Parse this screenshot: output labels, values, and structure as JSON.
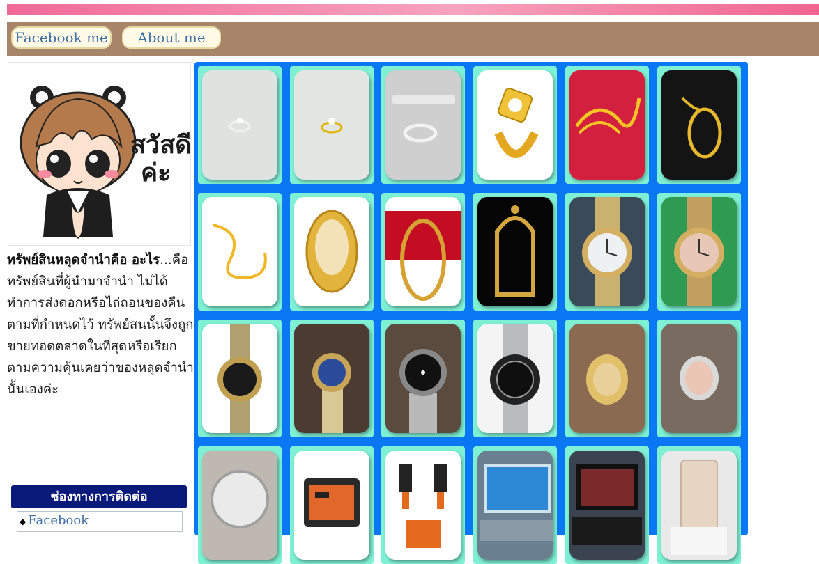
{
  "nav": {
    "facebook_label": "Facebook me",
    "about_label": "About me"
  },
  "sidebar": {
    "mascot_text_line1": "สวัสดี",
    "mascot_text_line2": "ค่ะ",
    "info_heading": "ทรัพย์สินหลุดจำนำคือ อะไร",
    "info_body": "...คือ ทรัพย์สินที่ผู้นำมาจำนำ ไม่ได้ทำการส่งดอกหรือไถ่ถอนของคืนตามที่กำหนดไว้ ทรัพย์สนนั้นจึงถูกขายทอดตลาดในที่สุดหรือเรียกตามความคุ้นเคยว่าของหลุดจำนำนั้นเองค่ะ",
    "contact_header": "ช่องทางการติดต่อ",
    "contact_link": "Facebook"
  },
  "gallery": {
    "items": [
      {
        "name": "silver-diamond-ring-photo"
      },
      {
        "name": "gold-diamond-ring-photo"
      },
      {
        "name": "silver-band-ring-photo"
      },
      {
        "name": "gold-mens-diamond-ring-photo"
      },
      {
        "name": "gold-chain-red-background-photo"
      },
      {
        "name": "gold-necklace-black-background-photo"
      },
      {
        "name": "gold-chain-white-background-photo"
      },
      {
        "name": "gold-amulet-case-photo"
      },
      {
        "name": "gold-amulet-frame-red-photo"
      },
      {
        "name": "gold-amulet-frame-black-photo"
      },
      {
        "name": "rolex-datejust-white-dial-photo"
      },
      {
        "name": "rolex-datejust-rose-dial-photo"
      },
      {
        "name": "rolex-gmt-two-tone-photo"
      },
      {
        "name": "rolex-lady-datejust-blue-dial-photo"
      },
      {
        "name": "rolex-submariner-on-wrist-photo"
      },
      {
        "name": "rolex-submariner-black-photo"
      },
      {
        "name": "rolex-day-date-gold-photo"
      },
      {
        "name": "rolex-datejust-pink-dial-photo"
      },
      {
        "name": "rolex-silver-dial-photo"
      },
      {
        "name": "tool-kit-case-photo"
      },
      {
        "name": "cordless-drill-set-photo"
      },
      {
        "name": "laptop-windows-photo"
      },
      {
        "name": "gaming-laptop-photo"
      },
      {
        "name": "iphone-gold-photo"
      }
    ]
  },
  "colors": {
    "gallery_background": "#0a78f4",
    "tile_frame": "#7ef0d4",
    "nav_background": "#a88468",
    "contact_header_background": "#0a1a7a"
  }
}
